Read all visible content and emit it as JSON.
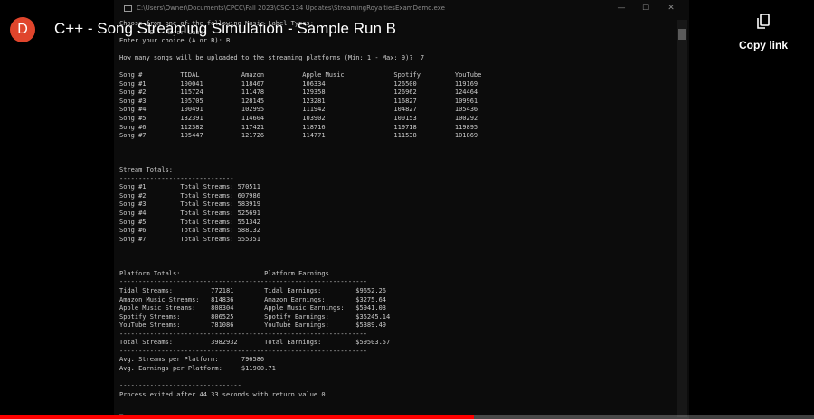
{
  "video": {
    "title": "C++ - Song Streaming Simulation - Sample Run B",
    "channel_initial": "D",
    "copy_link_label": "Copy link",
    "progress_fraction": 0.582
  },
  "colors": {
    "accent": "#ff0000",
    "avatar": "#e0452c"
  },
  "icons": {
    "copy": "copy-icon",
    "console": "console-window-icon"
  },
  "window": {
    "path": "C:\\Users\\Owner\\Documents\\CPCC\\Fall 2023\\CSC-134 Updates\\StreamingRoyaltiesExamDemo.exe",
    "minimize": "—",
    "maximize": "☐",
    "close": "✕"
  },
  "console": {
    "lines": [
      "Choose from one of the following Music Label Types:",
      "        B - Major Label",
      "Enter your choice (A or B): B",
      "",
      "How many songs will be uploaded to the streaming platforms (Min: 1 - Max: 9)?  7",
      "",
      "Song #          TIDAL           Amazon          Apple Music             Spotify         YouTube",
      "Song #1         100041          118467          106334                  126500          119169",
      "Song #2         115724          111478          129358                  126962          124464",
      "Song #3         105705          128145          123281                  116827          109961",
      "Song #4         100491          102995          111942                  104827          105436",
      "Song #5         132391          114604          103902                  100153          100292",
      "Song #6         112382          117421          118716                  119718          119895",
      "Song #7         105447          121726          114771                  111538          101869",
      "",
      "",
      "",
      "Stream Totals:",
      "------------------------------",
      "Song #1         Total Streams: 570511",
      "Song #2         Total Streams: 607986",
      "Song #3         Total Streams: 583919",
      "Song #4         Total Streams: 525691",
      "Song #5         Total Streams: 551342",
      "Song #6         Total Streams: 588132",
      "Song #7         Total Streams: 555351",
      "",
      "",
      "",
      "Platform Totals:                      Platform Earnings",
      "-----------------------------------------------------------------",
      "Tidal Streams:          772181        Tidal Earnings:         $9652.26",
      "Amazon Music Streams:   814836        Amazon Earnings:        $3275.64",
      "Apple Music Streams:    808304        Apple Music Earnings:   $5941.03",
      "Spotify Streams:        806525        Spotify Earnings:       $35245.14",
      "YouTube Streams:        781086        YouTube Earnings:       $5389.49",
      "-----------------------------------------------------------------",
      "Total Streams:          3982932       Total Earnings:         $59503.57",
      "-----------------------------------------------------------------",
      "Avg. Streams per Platform:      796586",
      "Avg. Earnings per Platform:     $11900.71",
      "",
      "--------------------------------",
      "Process exited after 44.33 seconds with return value 0",
      "",
      "_"
    ]
  }
}
